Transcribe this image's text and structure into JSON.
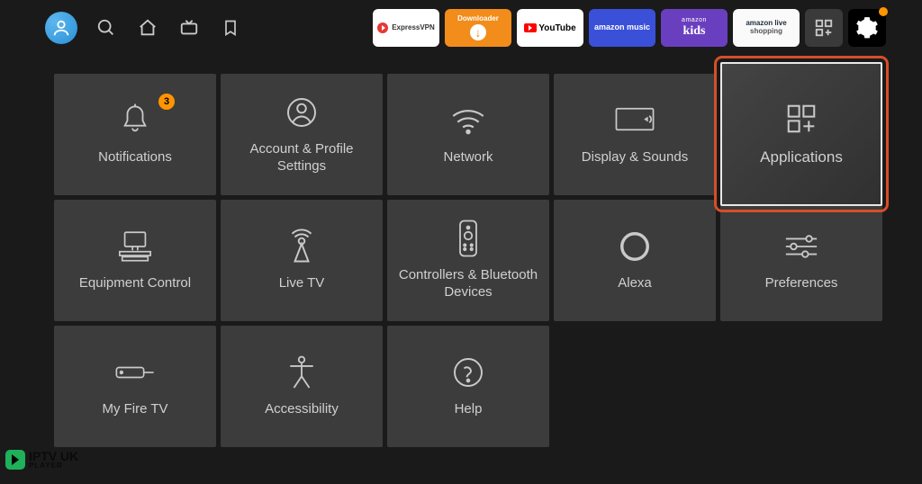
{
  "topbar": {
    "shortcuts": [
      {
        "name": "expressvpn",
        "label": "ExpressVPN"
      },
      {
        "name": "downloader",
        "label": "Downloader"
      },
      {
        "name": "youtube",
        "label": "YouTube"
      },
      {
        "name": "amazon-music",
        "label": "amazon music"
      },
      {
        "name": "amazon-kids",
        "label_top": "amazon",
        "label": "kids"
      },
      {
        "name": "amazon-live",
        "label": "amazon live",
        "sub": "shopping"
      }
    ]
  },
  "settings": {
    "tiles": [
      {
        "id": "notifications",
        "label": "Notifications",
        "badge": "3"
      },
      {
        "id": "account-profile",
        "label": "Account & Profile Settings"
      },
      {
        "id": "network",
        "label": "Network"
      },
      {
        "id": "display-sounds",
        "label": "Display & Sounds"
      },
      {
        "id": "applications",
        "label": "Applications",
        "selected": true
      },
      {
        "id": "equipment-control",
        "label": "Equipment Control"
      },
      {
        "id": "live-tv",
        "label": "Live TV"
      },
      {
        "id": "controllers-bluetooth",
        "label": "Controllers & Bluetooth Devices"
      },
      {
        "id": "alexa",
        "label": "Alexa"
      },
      {
        "id": "preferences",
        "label": "Preferences"
      },
      {
        "id": "my-fire-tv",
        "label": "My Fire TV"
      },
      {
        "id": "accessibility",
        "label": "Accessibility"
      },
      {
        "id": "help",
        "label": "Help"
      }
    ]
  },
  "watermark": {
    "brand": "IPTV UK",
    "sub": "PLAYER"
  }
}
